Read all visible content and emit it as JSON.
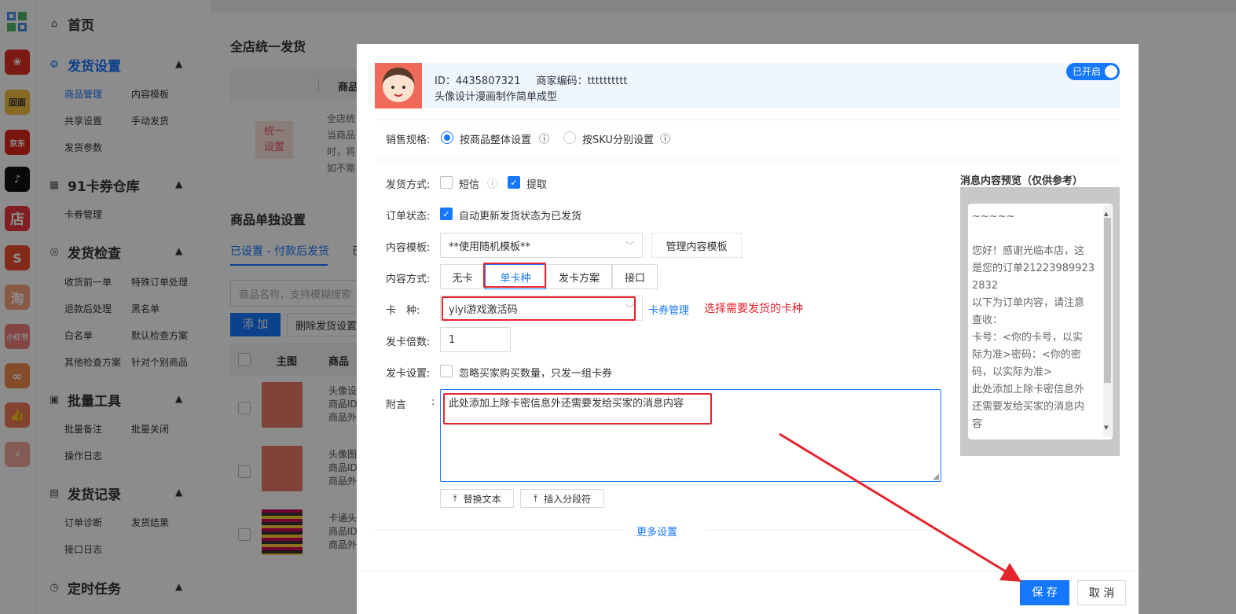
{
  "nav": {
    "home": "首页",
    "group1": {
      "title": "发货设置",
      "items": [
        "商品管理",
        "内容模板",
        "共享设置",
        "手动发货",
        "发货参数"
      ]
    },
    "group2": {
      "title": "91卡券仓库",
      "items": [
        "卡券管理"
      ]
    },
    "group3": {
      "title": "发货检查",
      "items": [
        "收货前一单",
        "特殊订单处理",
        "退款后处理",
        "黑名单",
        "白名单",
        "默认检查方案",
        "其他检查方案",
        "针对个别商品"
      ]
    },
    "group4": {
      "title": "批量工具",
      "items": [
        "批量备注",
        "批量关闭",
        "操作日志"
      ]
    },
    "group5": {
      "title": "发货记录",
      "items": [
        "订单诊断",
        "发货结果",
        "接口日志"
      ]
    },
    "group6": {
      "title": "定时任务"
    }
  },
  "apps": [
    "pdd",
    "固面",
    "京东",
    "抖音",
    "店",
    "shopee",
    "淘",
    "小红书",
    "app9",
    "app10",
    "app11"
  ],
  "main": {
    "title": "全店统一发货",
    "th": "商品",
    "unified_badge_1": "统一",
    "unified_badge_2": "设置",
    "desc": [
      "全店统",
      "当商品",
      "时，将",
      "如不需"
    ],
    "section": "商品单独设置",
    "tab_active": "已设置 - 付款后发货",
    "tab_other": "已",
    "search_placeholder": "商品名称，支持模糊搜索",
    "add": "添 加",
    "del": "删除发货设置",
    "col_main": "主图",
    "col_goods": "商品",
    "rows": [
      {
        "l1": "头像设",
        "l2": "商品ID",
        "l3": "商品外"
      },
      {
        "l1": "头像图",
        "l2": "商品ID",
        "l3": "商品外"
      },
      {
        "l1": "卡通头",
        "l2": "商品ID",
        "l3": "商品外"
      }
    ]
  },
  "modal": {
    "product": {
      "id": "ID：4435807321",
      "code": "商家编码：tttttttttt",
      "name": "头像设计漫画制作简单成型"
    },
    "toggle": "已开启",
    "spec_label": "销售规格:",
    "spec_opt1": "按商品整体设置",
    "spec_opt2": "按SKU分别设置",
    "ship_label": "发货方式:",
    "ship_sms": "短信",
    "ship_pick": "提取",
    "order_label": "订单状态:",
    "order_auto": "自动更新发货状态为已发货",
    "tpl_label": "内容模板:",
    "tpl_value": "**使用随机模板**",
    "tpl_manage": "管理内容模板",
    "mode_label": "内容方式:",
    "modes": [
      "无卡",
      "单卡种",
      "发卡方案",
      "接口"
    ],
    "card_label": "卡　种:",
    "card_value": "yiyi游戏激活码",
    "card_manage": "卡券管理",
    "card_hint": "选择需要发货的卡种",
    "mult_label": "发卡倍数:",
    "mult_value": "1",
    "set_label": "发卡设置:",
    "set_ignore": "忽略买家购买数量，只发一组卡券",
    "note_label": "附言",
    "note_colon": ":",
    "note_value": "此处添加上除卡密信息外还需要发给买家的消息内容",
    "replace": "替换文本",
    "insert": "插入分段符",
    "more": "更多设置",
    "preview_title": "消息内容预览（仅供参考）",
    "preview_lines": [
      "~~~~~",
      "",
      "您好！感谢光临本店，这",
      "是您的订单21223989923",
      "2832",
      "以下为订单内容，请注意",
      "查收：",
      "卡号：<你的卡号，以实",
      "际为准>密码：<你的密",
      "码，以实际为准>",
      "此处添加上除卡密信息外",
      "还需要发给买家的消息内",
      "容"
    ],
    "save": "保 存",
    "cancel": "取 消"
  },
  "colors": {
    "primary": "#1677ff",
    "highlight": "#e5252d",
    "mask": "rgba(0,0,0,0.45)"
  }
}
